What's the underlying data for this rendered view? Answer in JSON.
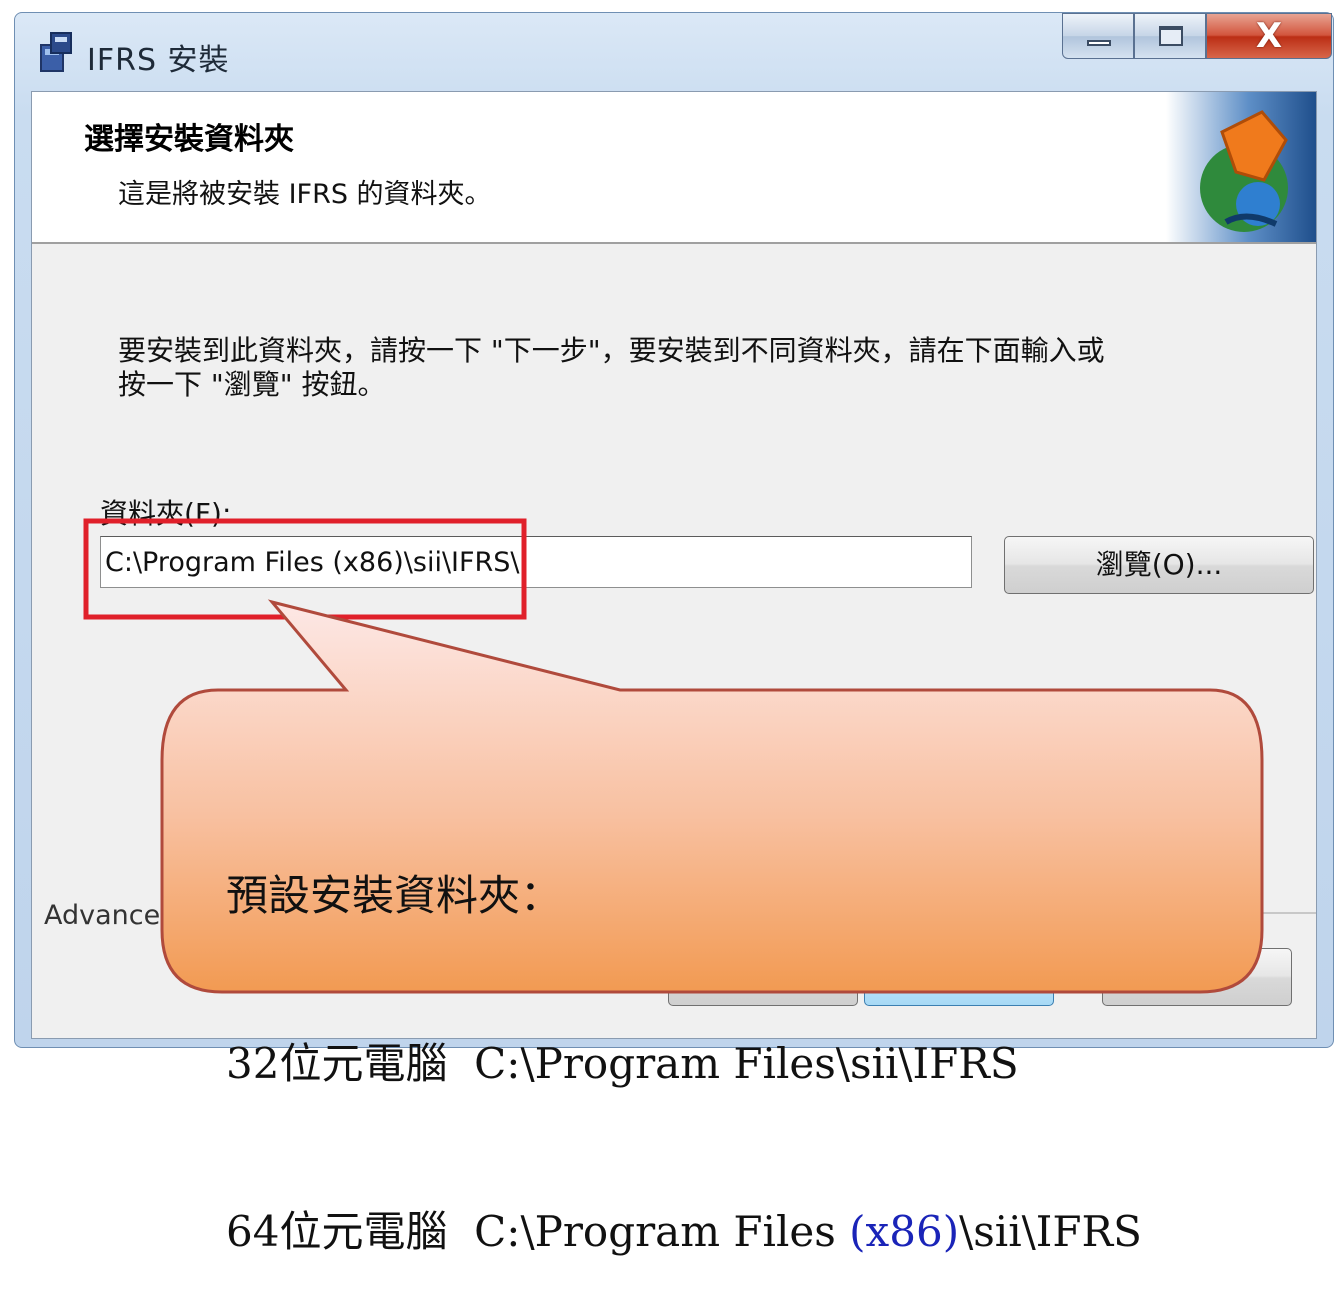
{
  "window": {
    "title": "IFRS 安裝",
    "controls": {
      "close": "X"
    }
  },
  "banner": {
    "title": "選擇安裝資料夾",
    "subtitle": "這是將被安裝 IFRS 的資料夾。"
  },
  "body": {
    "instructions_line1": "要安裝到此資料夾，請按一下 \"下一步\"，要安裝到不同資料夾，請在下面輸入或",
    "instructions_line2": "按一下 \"瀏覽\" 按鈕。",
    "folder_label": "資料夾(F):",
    "folder_value": "C:\\Program Files (x86)\\sii\\IFRS\\",
    "browse_button": "瀏覽(O)...",
    "advanced_label": "Advanced"
  },
  "callout": {
    "heading": "預設安裝資料夾：",
    "line32_prefix": "32位元電腦",
    "line32_path": "C:\\Program Files\\sii\\IFRS",
    "line64_prefix": "64位元電腦",
    "line64_path_a": "C:\\Program Files ",
    "line64_path_b": "(x86)",
    "line64_path_c": "\\sii\\IFRS"
  },
  "colors": {
    "highlight_box": "#e0202a",
    "callout_top": "#fde8e6",
    "callout_bottom": "#f29a52",
    "callout_border": "#b04a3c",
    "x86_text": "#1a24b8"
  }
}
